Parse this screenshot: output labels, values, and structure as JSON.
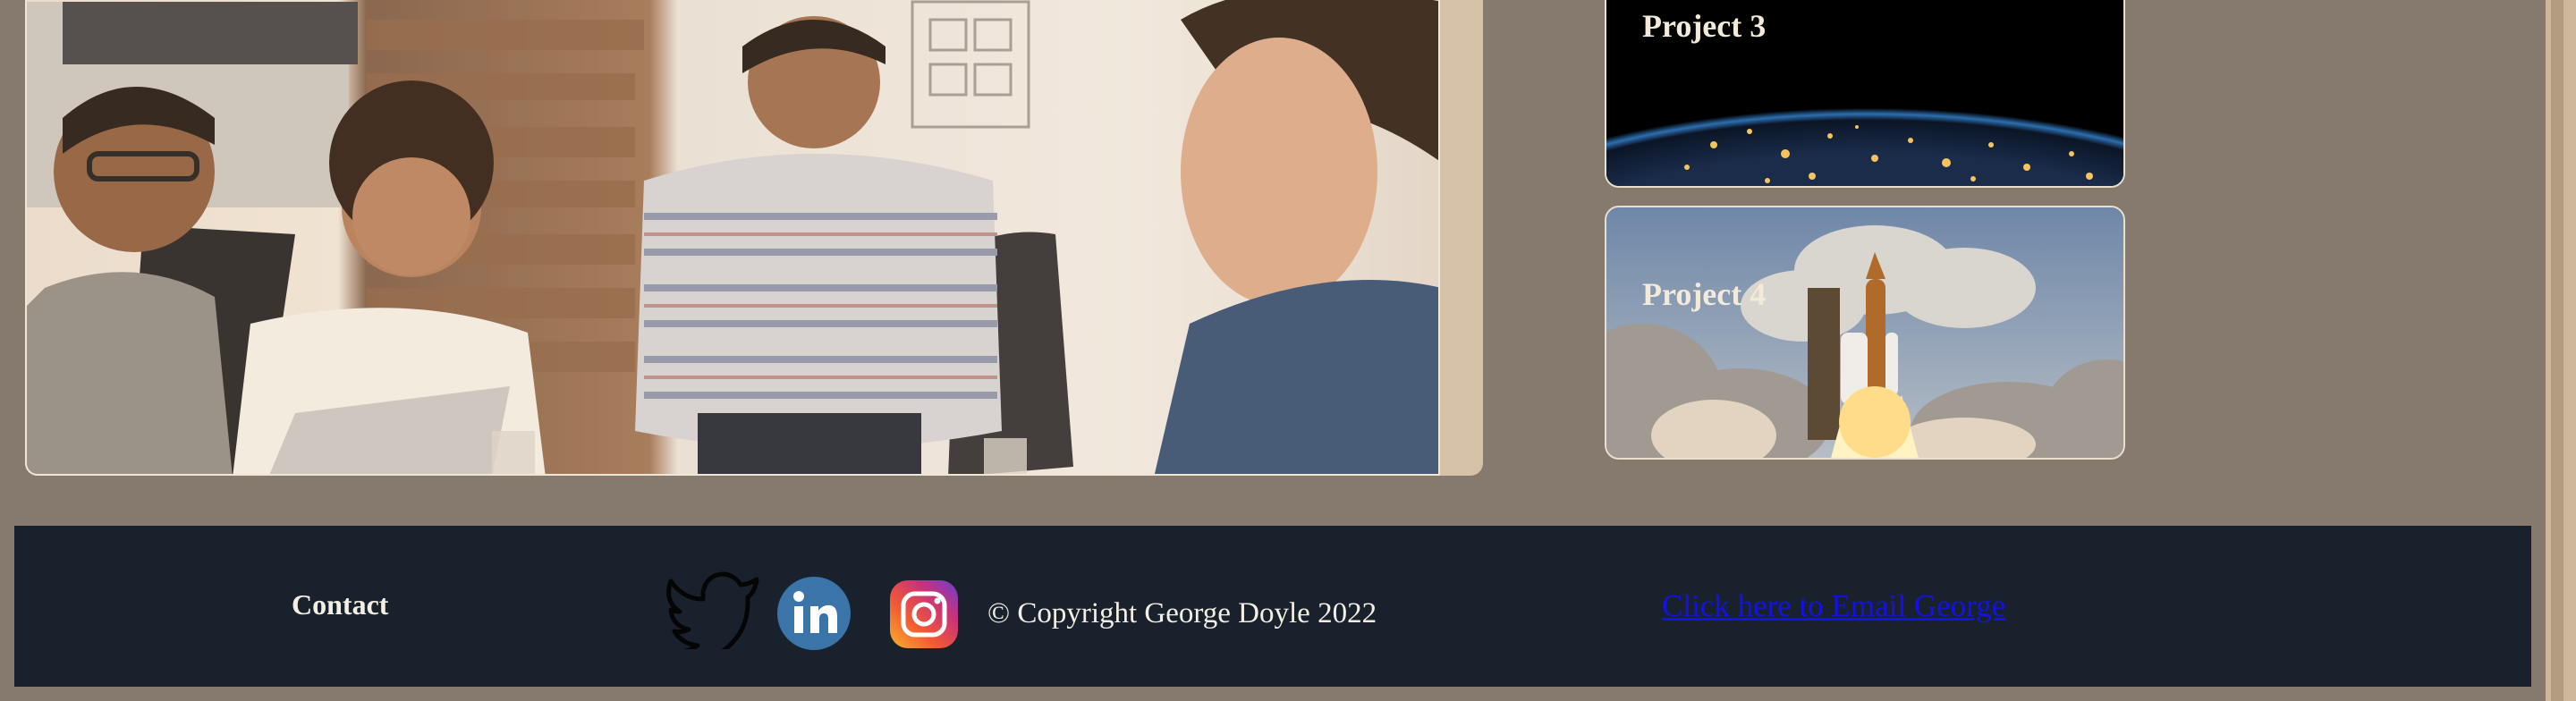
{
  "projects": [
    {
      "label": "Project 3"
    },
    {
      "label": "Project 4"
    }
  ],
  "footer": {
    "contact_label": "Contact",
    "copyright": "© Copyright George Doyle 2022",
    "email_link": "Click here to Email George",
    "social_icons": [
      "twitter-icon",
      "linkedin-icon",
      "instagram-icon"
    ]
  },
  "colors": {
    "page_background": "#867a6e",
    "footer_background": "#19222c",
    "link": "#1111e8",
    "card_border": "#e9dfcd",
    "text_light": "#f4efe4"
  }
}
